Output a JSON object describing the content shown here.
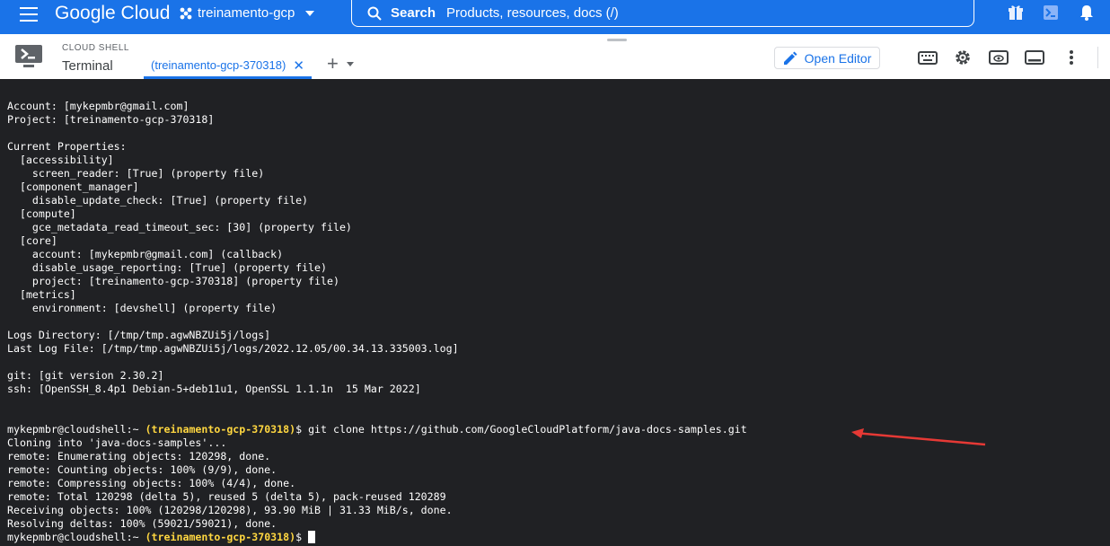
{
  "topbar": {
    "brand": "Google Cloud",
    "project_name": "treinamento-gcp",
    "search_label": "Search",
    "search_placeholder": "Products, resources, docs (/)",
    "icons": [
      "gift-icon",
      "terminal-icon",
      "notifications-icon"
    ],
    "accent_color": "#1a73e8"
  },
  "shell": {
    "section_label": "CLOUD SHELL",
    "title": "Terminal",
    "tab_label": "(treinamento-gcp-370318)",
    "open_editor_label": "Open Editor",
    "toolbar_icons": [
      "keyboard-icon",
      "settings-icon",
      "web-preview-icon",
      "minimize-icon",
      "more-vert-icon"
    ]
  },
  "terminal": {
    "lines": [
      "Account: [mykepmbr@gmail.com]",
      "Project: [treinamento-gcp-370318]",
      "",
      "Current Properties:",
      "  [accessibility]",
      "    screen_reader: [True] (property file)",
      "  [component_manager]",
      "    disable_update_check: [True] (property file)",
      "  [compute]",
      "    gce_metadata_read_timeout_sec: [30] (property file)",
      "  [core]",
      "    account: [mykepmbr@gmail.com] (callback)",
      "    disable_usage_reporting: [True] (property file)",
      "    project: [treinamento-gcp-370318] (property file)",
      "  [metrics]",
      "    environment: [devshell] (property file)",
      "",
      "Logs Directory: [/tmp/tmp.agwNBZUi5j/logs]",
      "Last Log File: [/tmp/tmp.agwNBZUi5j/logs/2022.12.05/00.34.13.335003.log]",
      "",
      "git: [git version 2.30.2]",
      "ssh: [OpenSSH_8.4p1 Debian-5+deb11u1, OpenSSL 1.1.1n  15 Mar 2022]"
    ],
    "prompt_user": "mykepmbr@cloudshell:~",
    "prompt_project": "(treinamento-gcp-370318)",
    "command": "$ git clone https://github.com/GoogleCloudPlatform/java-docs-samples.git",
    "output": [
      "Cloning into 'java-docs-samples'...",
      "remote: Enumerating objects: 120298, done.",
      "remote: Counting objects: 100% (9/9), done.",
      "remote: Compressing objects: 100% (4/4), done.",
      "remote: Total 120298 (delta 5), reused 5 (delta 5), pack-reused 120289",
      "Receiving objects: 100% (120298/120298), 93.90 MiB | 31.33 MiB/s, done.",
      "Resolving deltas: 100% (59021/59021), done."
    ],
    "final_prompt_suffix": "$",
    "annotation_arrow_color": "#e53935"
  }
}
